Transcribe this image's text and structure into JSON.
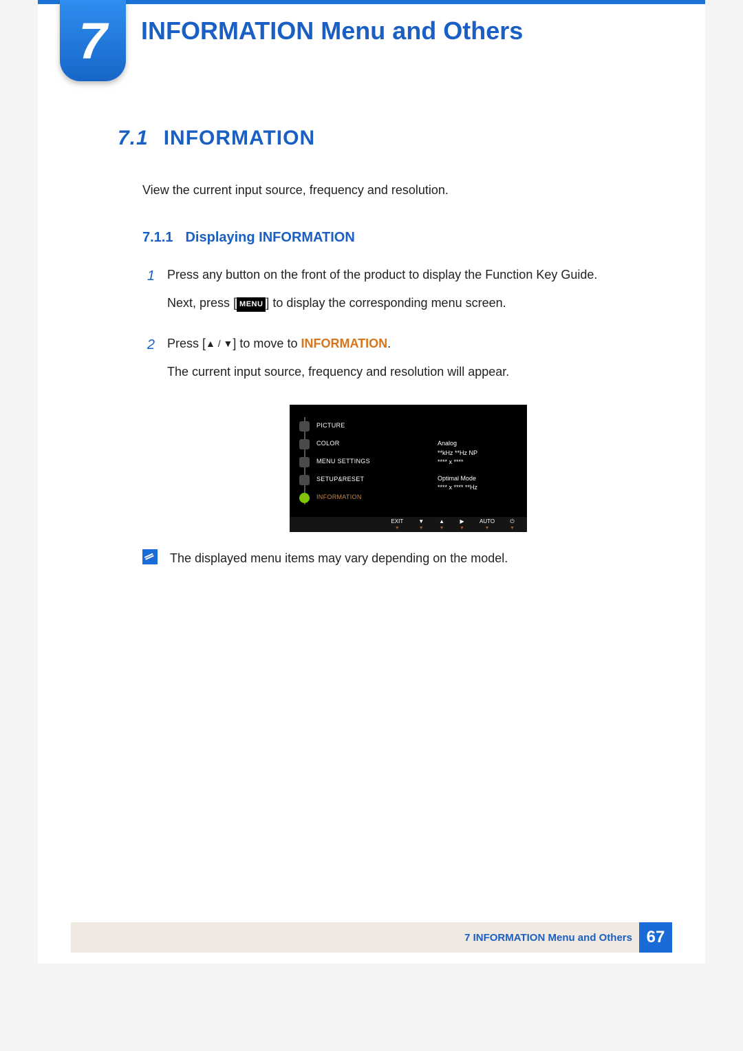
{
  "chapter": {
    "number": "7",
    "title": "INFORMATION Menu and Others"
  },
  "section": {
    "number": "7.1",
    "title": "INFORMATION",
    "intro": "View the current input source, frequency and resolution."
  },
  "subsection": {
    "number": "7.1.1",
    "title": "Displaying INFORMATION"
  },
  "steps": [
    {
      "num": "1",
      "line1_a": "Press any button on the front of the product to display the Function Key Guide.",
      "line2_pre": "Next, press [",
      "key": "MENU",
      "line2_post": "] to display the corresponding menu screen."
    },
    {
      "num": "2",
      "line1_pre": "Press [",
      "arrows": "▲ / ▼",
      "line1_mid": "] to move to ",
      "highlight": "INFORMATION",
      "line1_post": ".",
      "line2": "The current input source, frequency and resolution will appear."
    }
  ],
  "osd": {
    "menu": [
      "PICTURE",
      "COLOR",
      "MENU SETTINGS",
      "SETUP&RESET",
      "INFORMATION"
    ],
    "info": {
      "l1": "Analog",
      "l2": "**kHz **Hz NP",
      "l3": "**** x ****",
      "l4": "Optimal Mode",
      "l5": "**** x **** **Hz"
    },
    "footer": [
      "EXIT",
      "▼",
      "▲",
      "▶",
      "AUTO",
      "⏻"
    ]
  },
  "note": "The displayed menu items may vary depending on the model.",
  "footer": {
    "text": "7 INFORMATION Menu and Others",
    "page": "67"
  }
}
